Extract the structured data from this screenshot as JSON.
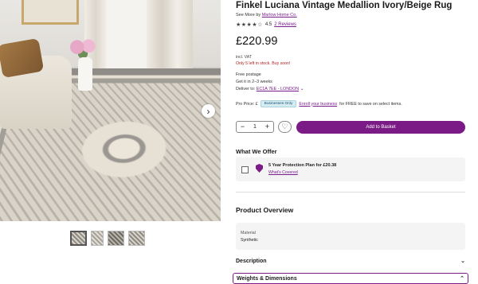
{
  "product": {
    "title": "Finkel Luciana Vintage Medallion Ivory/Beige Rug",
    "see_more_prefix": "See More by",
    "brand": "Marlow Home Co.",
    "stars": "★★★★☆",
    "rating": "4.5",
    "reviews": "2 Reviews",
    "price": "£220.99",
    "vat": "incl. VAT",
    "stock": "Only 5 left in stock. Buy soon!"
  },
  "shipping": {
    "postage": "Free postage",
    "eta": "Get it in 2–3 weeks",
    "deliver_prefix": "Deliver to:",
    "location": "EC1A 7EE - LONDON"
  },
  "pro": {
    "label": "Pro Price: £",
    "badge": "Businesses Only",
    "enroll": "Enroll your business",
    "suffix": "for FREE to save on select items."
  },
  "purchase": {
    "minus": "−",
    "quantity": "1",
    "plus": "+",
    "wish_icon": "♡",
    "add_to_basket": "Add to Basket"
  },
  "offer": {
    "heading": "What We Offer",
    "plan": "5 Year Protection Plan for £20.38",
    "covered": "What's Covered"
  },
  "overview": {
    "heading": "Product Overview",
    "material_label": "Material",
    "material_value": "Synthetic"
  },
  "accordions": {
    "description": "Description",
    "weights": "Weights & Dimensions"
  },
  "gallery": {
    "next_icon": "›"
  }
}
